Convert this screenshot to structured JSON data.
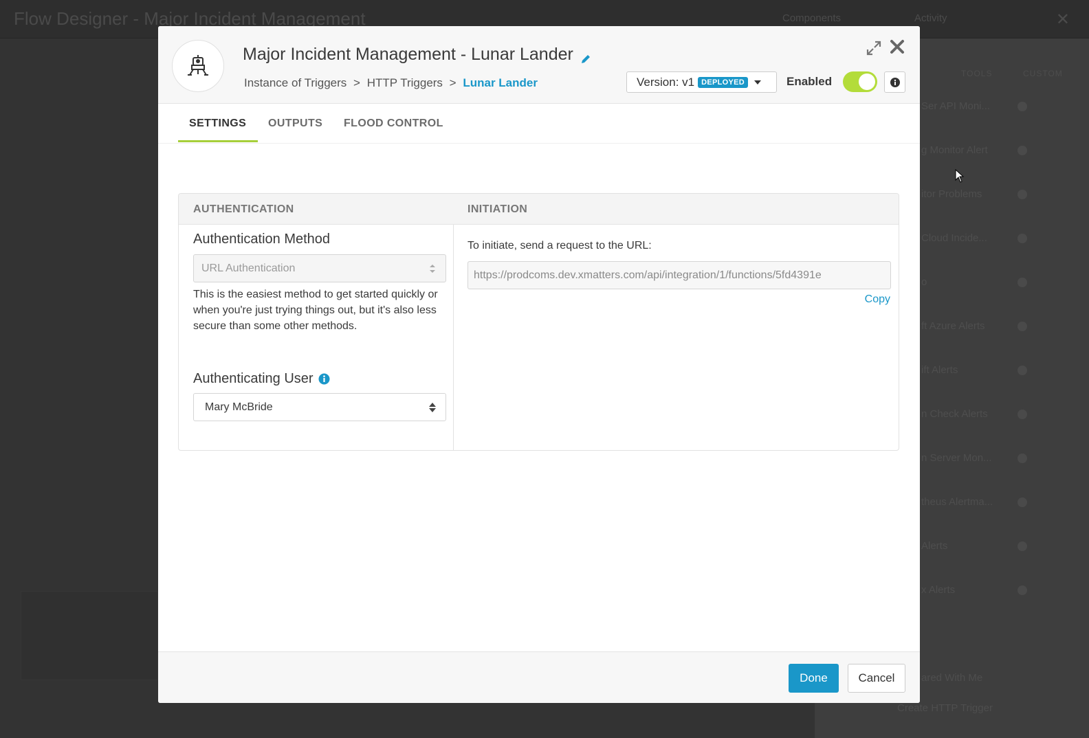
{
  "background": {
    "title": "Flow Designer - Major Incident Management",
    "nav": [
      "Components",
      "Activity"
    ],
    "tools": [
      "TOOLS",
      "CUSTOM"
    ],
    "list_items": [
      "Ser API Moni...",
      "g Monitor Alert",
      "itor Problems",
      "Cloud Incide...",
      "o",
      "ft Azure Alerts",
      "ift Alerts",
      "n Check Alerts",
      "n Server Mon...",
      "theus Alertma...",
      "Alerts",
      "x Alerts",
      "ared With Me",
      "Create HTTP Trigger"
    ]
  },
  "modal": {
    "title": "Major Incident Management - Lunar Lander",
    "breadcrumb": {
      "part1": "Instance of Triggers",
      "sep1": ">",
      "part2": "HTTP Triggers",
      "sep2": ">",
      "current": "Lunar Lander"
    },
    "version": {
      "label": "Version: v1",
      "badge": "DEPLOYED"
    },
    "enabled_label": "Enabled",
    "enabled": true,
    "tabs": [
      "SETTINGS",
      "OUTPUTS",
      "FLOOD CONTROL"
    ],
    "active_tab": "SETTINGS",
    "authentication": {
      "header": "AUTHENTICATION",
      "method_title": "Authentication Method",
      "method_value": "URL Authentication",
      "help": "This is the easiest method to get started quickly or when you're just trying things out, but it's also less secure than some other methods.",
      "user_title": "Authenticating User",
      "user_value": "Mary McBride"
    },
    "initiation": {
      "header": "INITIATION",
      "label": "To initiate, send a request to the URL:",
      "url": "https://prodcoms.dev.xmatters.com/api/integration/1/functions/5fd4391e",
      "copy": "Copy"
    },
    "footer": {
      "done": "Done",
      "cancel": "Cancel"
    }
  },
  "colors": {
    "accent": "#1a97c9",
    "toggle_on": "#b3dc3a",
    "tab_underline": "#a6cf3a"
  }
}
